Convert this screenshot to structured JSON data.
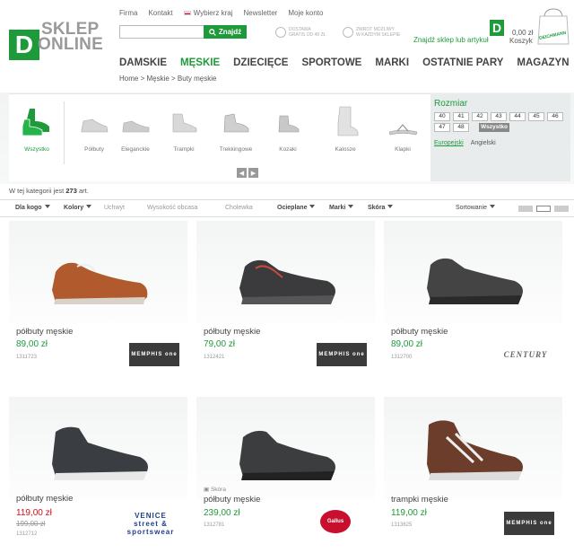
{
  "header": {
    "logo_letter": "D",
    "logo_line1": "SKLEP",
    "logo_line2": "ONLINE",
    "toplinks": [
      "Firma",
      "Kontakt",
      "Wybierz kraj",
      "Newsletter",
      "Moje konto"
    ],
    "search_placeholder": "",
    "search_button": "Znajdź",
    "promo1": [
      "DOSTAWA",
      "GRATIS OD 49 ZŁ"
    ],
    "promo2": [
      "ZWROT MOŻLIWY",
      "W KAŻDYM SKLEPIE"
    ],
    "store_link": "Znajdź sklep lub artykuł",
    "cart_price": "0,00 zł",
    "cart_label": "Koszyk",
    "bag_text": "DEICHMANN"
  },
  "nav": [
    "DAMSKIE",
    "MĘSKIE",
    "DZIECIĘCE",
    "SPORTOWE",
    "MARKI",
    "OSTATNIE PARY",
    "MAGAZYN"
  ],
  "nav_active": "MĘSKIE",
  "breadcrumb": "Home > Męskie > Buty męskie",
  "categories": [
    "Wszystko",
    "Półbuty",
    "Eleganckie",
    "Trampki",
    "Trekkingowe",
    "Kozaki",
    "Kalosze",
    "Klapki"
  ],
  "category_active": "Wszystko",
  "sizes": {
    "title": "Rozmiar",
    "values": [
      "40",
      "41",
      "42",
      "43",
      "44",
      "45",
      "46",
      "47",
      "48"
    ],
    "extended_button": "Wszystko",
    "system_active": "Europejski",
    "system_other": "Angielski"
  },
  "count_text_before": "W tej kategorii jest",
  "count_value": "273",
  "count_text_after": "art.",
  "filters": [
    {
      "label": "Dla kogo",
      "enabled": true
    },
    {
      "label": "Kolory",
      "enabled": true
    },
    {
      "label": "Uchwyt",
      "enabled": false
    },
    {
      "label": "Wysokość obcasa",
      "enabled": false
    },
    {
      "label": "Cholewka",
      "enabled": false
    },
    {
      "label": "Ocieplane",
      "enabled": true
    },
    {
      "label": "Marki",
      "enabled": true
    },
    {
      "label": "Skóra",
      "enabled": true
    }
  ],
  "sort_label": "Sortowanie",
  "products": [
    {
      "name": "półbuty męskie",
      "price": "89,00 zł",
      "code": "1311723",
      "brand": "MEMPHIS one",
      "color": "#b05a2e"
    },
    {
      "name": "półbuty męskie",
      "price": "79,00 zł",
      "code": "1312421",
      "brand": "MEMPHIS one",
      "color": "#3b3b3d"
    },
    {
      "name": "półbuty męskie",
      "price": "89,00 zł",
      "code": "1312700",
      "brand": "CENTURY",
      "color": "#444"
    },
    {
      "name": "półbuty męskie",
      "price": "119,00 zł",
      "old_price": "199,00 zł",
      "code": "1312712",
      "brand": "VENICE street & sportswear",
      "color": "#3a3d42"
    },
    {
      "name": "półbuty męskie",
      "sub": "Skóra",
      "price": "239,00 zł",
      "code": "1312781",
      "brand": "Gallus",
      "color": "#3c3d3f"
    },
    {
      "name": "trampki męskie",
      "price": "119,00 zł",
      "code": "1313625",
      "brand": "MEMPHIS one",
      "color": "#6b3d2a"
    }
  ]
}
